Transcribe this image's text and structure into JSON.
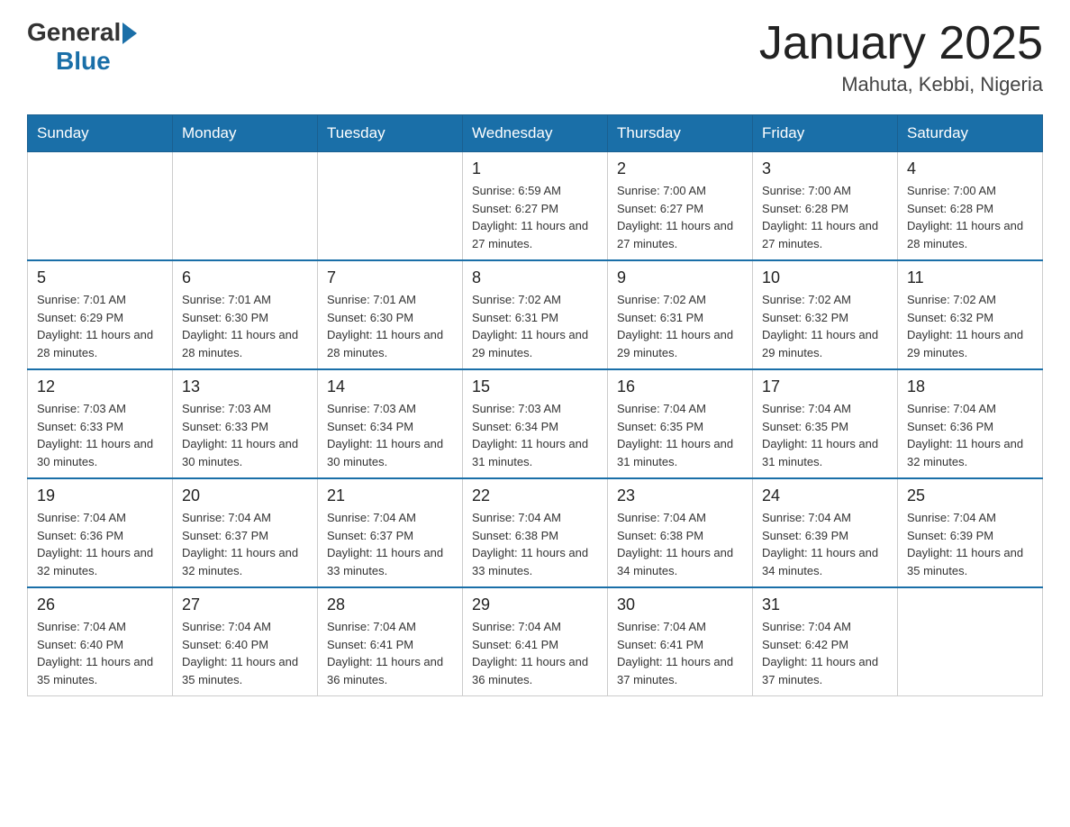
{
  "header": {
    "logo_general": "General",
    "logo_blue": "Blue",
    "title": "January 2025",
    "subtitle": "Mahuta, Kebbi, Nigeria"
  },
  "weekdays": [
    "Sunday",
    "Monday",
    "Tuesday",
    "Wednesday",
    "Thursday",
    "Friday",
    "Saturday"
  ],
  "weeks": [
    [
      {
        "num": "",
        "sunrise": "",
        "sunset": "",
        "daylight": ""
      },
      {
        "num": "",
        "sunrise": "",
        "sunset": "",
        "daylight": ""
      },
      {
        "num": "",
        "sunrise": "",
        "sunset": "",
        "daylight": ""
      },
      {
        "num": "1",
        "sunrise": "Sunrise: 6:59 AM",
        "sunset": "Sunset: 6:27 PM",
        "daylight": "Daylight: 11 hours and 27 minutes."
      },
      {
        "num": "2",
        "sunrise": "Sunrise: 7:00 AM",
        "sunset": "Sunset: 6:27 PM",
        "daylight": "Daylight: 11 hours and 27 minutes."
      },
      {
        "num": "3",
        "sunrise": "Sunrise: 7:00 AM",
        "sunset": "Sunset: 6:28 PM",
        "daylight": "Daylight: 11 hours and 27 minutes."
      },
      {
        "num": "4",
        "sunrise": "Sunrise: 7:00 AM",
        "sunset": "Sunset: 6:28 PM",
        "daylight": "Daylight: 11 hours and 28 minutes."
      }
    ],
    [
      {
        "num": "5",
        "sunrise": "Sunrise: 7:01 AM",
        "sunset": "Sunset: 6:29 PM",
        "daylight": "Daylight: 11 hours and 28 minutes."
      },
      {
        "num": "6",
        "sunrise": "Sunrise: 7:01 AM",
        "sunset": "Sunset: 6:30 PM",
        "daylight": "Daylight: 11 hours and 28 minutes."
      },
      {
        "num": "7",
        "sunrise": "Sunrise: 7:01 AM",
        "sunset": "Sunset: 6:30 PM",
        "daylight": "Daylight: 11 hours and 28 minutes."
      },
      {
        "num": "8",
        "sunrise": "Sunrise: 7:02 AM",
        "sunset": "Sunset: 6:31 PM",
        "daylight": "Daylight: 11 hours and 29 minutes."
      },
      {
        "num": "9",
        "sunrise": "Sunrise: 7:02 AM",
        "sunset": "Sunset: 6:31 PM",
        "daylight": "Daylight: 11 hours and 29 minutes."
      },
      {
        "num": "10",
        "sunrise": "Sunrise: 7:02 AM",
        "sunset": "Sunset: 6:32 PM",
        "daylight": "Daylight: 11 hours and 29 minutes."
      },
      {
        "num": "11",
        "sunrise": "Sunrise: 7:02 AM",
        "sunset": "Sunset: 6:32 PM",
        "daylight": "Daylight: 11 hours and 29 minutes."
      }
    ],
    [
      {
        "num": "12",
        "sunrise": "Sunrise: 7:03 AM",
        "sunset": "Sunset: 6:33 PM",
        "daylight": "Daylight: 11 hours and 30 minutes."
      },
      {
        "num": "13",
        "sunrise": "Sunrise: 7:03 AM",
        "sunset": "Sunset: 6:33 PM",
        "daylight": "Daylight: 11 hours and 30 minutes."
      },
      {
        "num": "14",
        "sunrise": "Sunrise: 7:03 AM",
        "sunset": "Sunset: 6:34 PM",
        "daylight": "Daylight: 11 hours and 30 minutes."
      },
      {
        "num": "15",
        "sunrise": "Sunrise: 7:03 AM",
        "sunset": "Sunset: 6:34 PM",
        "daylight": "Daylight: 11 hours and 31 minutes."
      },
      {
        "num": "16",
        "sunrise": "Sunrise: 7:04 AM",
        "sunset": "Sunset: 6:35 PM",
        "daylight": "Daylight: 11 hours and 31 minutes."
      },
      {
        "num": "17",
        "sunrise": "Sunrise: 7:04 AM",
        "sunset": "Sunset: 6:35 PM",
        "daylight": "Daylight: 11 hours and 31 minutes."
      },
      {
        "num": "18",
        "sunrise": "Sunrise: 7:04 AM",
        "sunset": "Sunset: 6:36 PM",
        "daylight": "Daylight: 11 hours and 32 minutes."
      }
    ],
    [
      {
        "num": "19",
        "sunrise": "Sunrise: 7:04 AM",
        "sunset": "Sunset: 6:36 PM",
        "daylight": "Daylight: 11 hours and 32 minutes."
      },
      {
        "num": "20",
        "sunrise": "Sunrise: 7:04 AM",
        "sunset": "Sunset: 6:37 PM",
        "daylight": "Daylight: 11 hours and 32 minutes."
      },
      {
        "num": "21",
        "sunrise": "Sunrise: 7:04 AM",
        "sunset": "Sunset: 6:37 PM",
        "daylight": "Daylight: 11 hours and 33 minutes."
      },
      {
        "num": "22",
        "sunrise": "Sunrise: 7:04 AM",
        "sunset": "Sunset: 6:38 PM",
        "daylight": "Daylight: 11 hours and 33 minutes."
      },
      {
        "num": "23",
        "sunrise": "Sunrise: 7:04 AM",
        "sunset": "Sunset: 6:38 PM",
        "daylight": "Daylight: 11 hours and 34 minutes."
      },
      {
        "num": "24",
        "sunrise": "Sunrise: 7:04 AM",
        "sunset": "Sunset: 6:39 PM",
        "daylight": "Daylight: 11 hours and 34 minutes."
      },
      {
        "num": "25",
        "sunrise": "Sunrise: 7:04 AM",
        "sunset": "Sunset: 6:39 PM",
        "daylight": "Daylight: 11 hours and 35 minutes."
      }
    ],
    [
      {
        "num": "26",
        "sunrise": "Sunrise: 7:04 AM",
        "sunset": "Sunset: 6:40 PM",
        "daylight": "Daylight: 11 hours and 35 minutes."
      },
      {
        "num": "27",
        "sunrise": "Sunrise: 7:04 AM",
        "sunset": "Sunset: 6:40 PM",
        "daylight": "Daylight: 11 hours and 35 minutes."
      },
      {
        "num": "28",
        "sunrise": "Sunrise: 7:04 AM",
        "sunset": "Sunset: 6:41 PM",
        "daylight": "Daylight: 11 hours and 36 minutes."
      },
      {
        "num": "29",
        "sunrise": "Sunrise: 7:04 AM",
        "sunset": "Sunset: 6:41 PM",
        "daylight": "Daylight: 11 hours and 36 minutes."
      },
      {
        "num": "30",
        "sunrise": "Sunrise: 7:04 AM",
        "sunset": "Sunset: 6:41 PM",
        "daylight": "Daylight: 11 hours and 37 minutes."
      },
      {
        "num": "31",
        "sunrise": "Sunrise: 7:04 AM",
        "sunset": "Sunset: 6:42 PM",
        "daylight": "Daylight: 11 hours and 37 minutes."
      },
      {
        "num": "",
        "sunrise": "",
        "sunset": "",
        "daylight": ""
      }
    ]
  ]
}
